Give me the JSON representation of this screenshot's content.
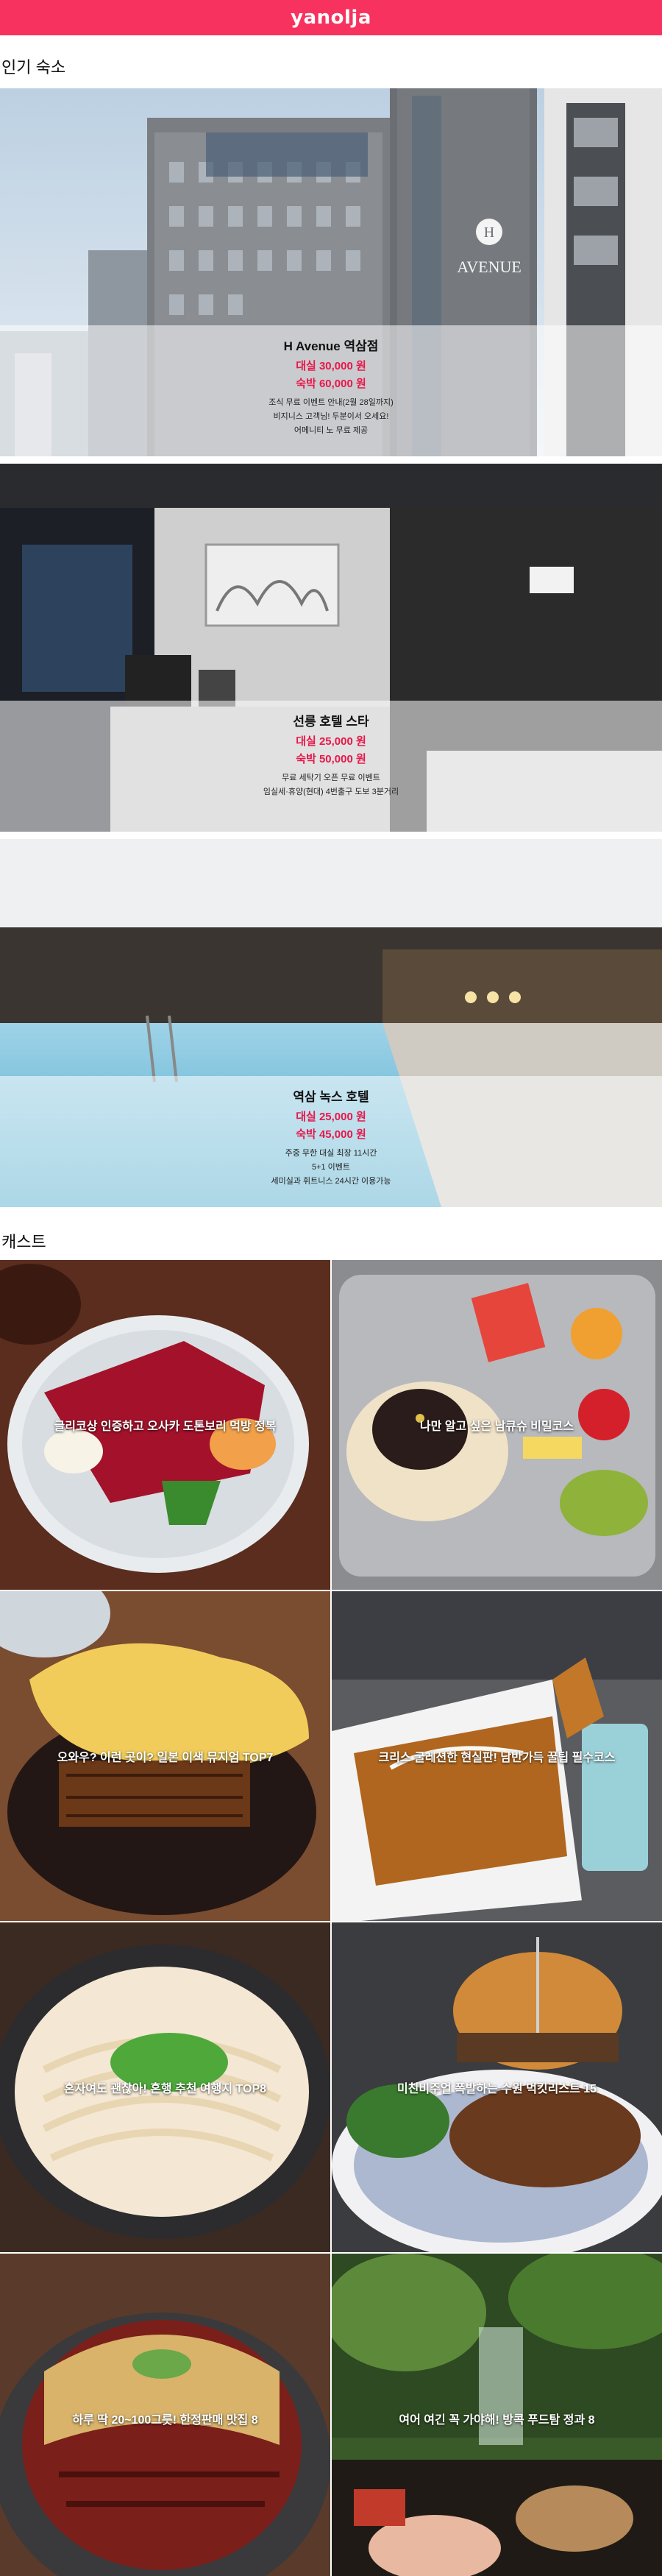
{
  "header": {
    "logo": "yanolja",
    "brand_color": "#f7325f"
  },
  "sections": {
    "popular_title": "인기 숙소",
    "cast_title": "캐스트"
  },
  "hotels": [
    {
      "name": "H Avenue 역삼점",
      "daesil": "대실 30,000 원",
      "sukbak": "숙박 60,000 원",
      "note1": "조식 무료 이벤트 안내(2월 28일까지)",
      "note2": "비지니스 고객님! 두분이서 오세요!",
      "note3": "어메니티 노 무료 제공",
      "sign": "AVENUE"
    },
    {
      "name": "선릉 호텔 스타",
      "daesil": "대실 25,000 원",
      "sukbak": "숙박 50,000 원",
      "note1": "무료 세탁기 오픈 무료 이벤트",
      "note2": "임실세·휴양(현대) 4번출구 도보 3분거리",
      "note3": ""
    },
    {
      "name": "역삼 녹스 호텔",
      "daesil": "대실 25,000 원",
      "sukbak": "숙박 45,000 원",
      "note1": "주중 무한 대실 최장 11시간",
      "note2": "5+1 이벤트",
      "note3": "세미실과 휘트니스 24시간 이용가능"
    }
  ],
  "casts": [
    {
      "title": "글리코상 인증하고 오사카 도톤보리 먹방 정복",
      "icon": "food-photo-icon"
    },
    {
      "title": "나만 알고 싶은 남큐슈 비밀코스",
      "icon": "food-photo-icon"
    },
    {
      "title": "오와우? 이런 곳이? 일본 이색 뮤지엄 TOP7",
      "icon": "food-photo-icon"
    },
    {
      "title": "크리스 굴레션한 현실판! 남반가득 꿀팁 필수코스",
      "icon": "food-photo-icon"
    },
    {
      "title": "혼자여도 괜찮아! 혼행 추천 여행지 TOP8",
      "icon": "food-photo-icon"
    },
    {
      "title": "미친비주얼 폭발하는 수원 먹킷리스트 15",
      "icon": "food-photo-icon"
    },
    {
      "title": "하루 딱 20~100그릇! 한정판매 맛집 8",
      "icon": "food-photo-icon"
    },
    {
      "title": "여어 여긴 꼭 가야해! 방콕 푸드탐 정과 8",
      "icon": "food-photo-icon"
    }
  ]
}
